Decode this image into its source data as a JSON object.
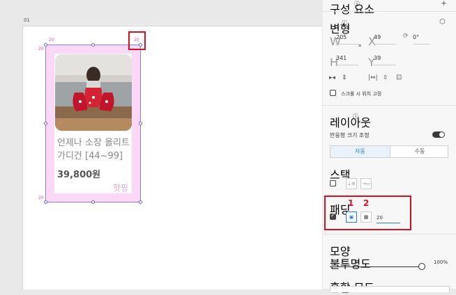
{
  "canvas": {
    "artboard_label": "01",
    "padding_values": {
      "top_left": "20",
      "top_right": "20",
      "left": "20",
      "bottom_left": "20"
    },
    "card": {
      "product_name": "언제나 소장 올리트 가디건 [44~99]",
      "price": "39,800원",
      "tag": "핫핑"
    }
  },
  "panel": {
    "component_title": "구성 요소",
    "component_info_icon": "info-icon",
    "add_icon": "+",
    "transform_title": "변형",
    "width_label": "W",
    "width_value": "205",
    "x_label": "X",
    "x_value": "49",
    "rotation_value": "0°",
    "height_label": "H",
    "height_value": "341",
    "y_label": "Y",
    "y_value": "39",
    "fix_on_scroll_label": "스크롤 시 위치 고정",
    "layout_title": "레이아웃",
    "responsive_resize_label": "반응형 크기 조정",
    "responsive_resize_on": true,
    "seg_auto": "자동",
    "seg_manual": "수동",
    "stack_title": "스택",
    "padding_title": "패딩",
    "padding_value": "20",
    "annotation_1": "1",
    "annotation_2": "2",
    "appearance_title": "모양",
    "opacity_label": "불투명도",
    "opacity_value": "100%",
    "blend_label": "혼합 모드"
  },
  "colors": {
    "highlight": "#d4121f",
    "selection": "#8a7cf0",
    "padding_overlay": "#fbd8f6",
    "accent": "#2a7ad6"
  }
}
